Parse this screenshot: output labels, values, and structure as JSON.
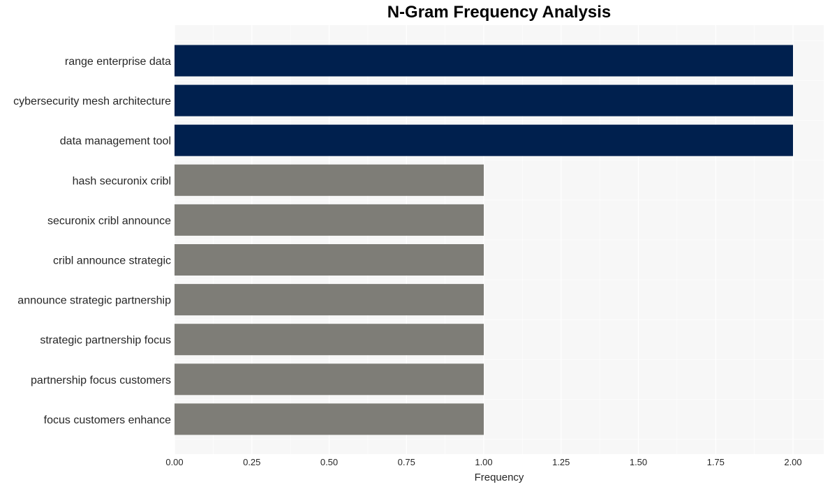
{
  "chart_data": {
    "type": "bar",
    "orientation": "horizontal",
    "title": "N-Gram Frequency Analysis",
    "xlabel": "Frequency",
    "ylabel": "",
    "xlim": [
      0,
      2.1
    ],
    "xticks": [
      0.0,
      0.25,
      0.5,
      0.75,
      1.0,
      1.25,
      1.5,
      1.75,
      2.0
    ],
    "xtick_labels": [
      "0.00",
      "0.25",
      "0.50",
      "0.75",
      "1.00",
      "1.25",
      "1.50",
      "1.75",
      "2.00"
    ],
    "grid": true,
    "categories": [
      "range enterprise data",
      "cybersecurity mesh architecture",
      "data management tool",
      "hash securonix cribl",
      "securonix cribl announce",
      "cribl announce strategic",
      "announce strategic partnership",
      "strategic partnership focus",
      "partnership focus customers",
      "focus customers enhance"
    ],
    "values": [
      2,
      2,
      2,
      1,
      1,
      1,
      1,
      1,
      1,
      1
    ],
    "colors": {
      "high": "#00204e",
      "low": "#7e7d77",
      "plot_background": "#f7f7f7",
      "grid": "#ffffff"
    }
  }
}
